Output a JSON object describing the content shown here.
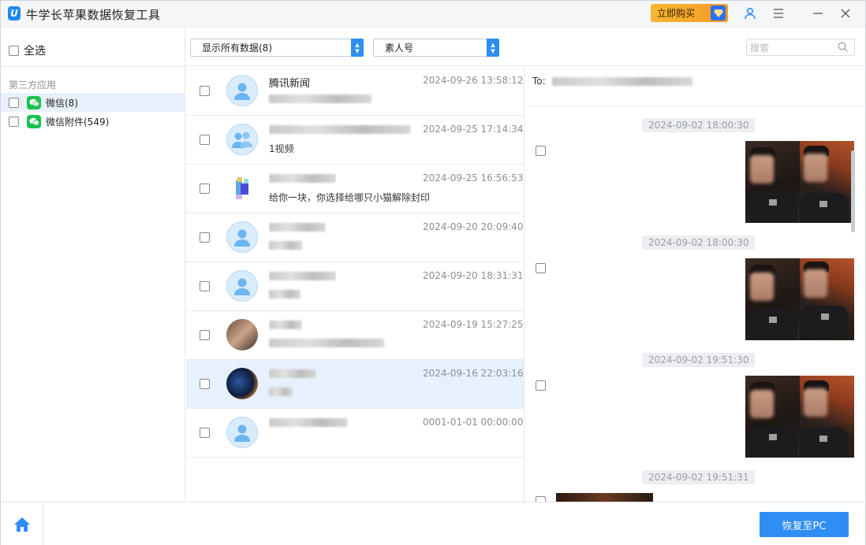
{
  "app": {
    "title": "牛学长苹果数据恢复工具",
    "logo_letter": "U",
    "buy_label": "立即购买",
    "accent": "#2f8ef4",
    "buy_color": "#f7b733",
    "icons": [
      "user-icon",
      "menu-icon",
      "minimize-icon",
      "close-icon"
    ]
  },
  "sidebar": {
    "select_all": "全选",
    "section": "第三方应用",
    "items": [
      {
        "label": "微信(8)",
        "active": true
      },
      {
        "label": "微信附件(549)",
        "active": false
      }
    ]
  },
  "toolbar": {
    "filter_value": "显示所有数据(8)",
    "type_value": "素人号",
    "search_placeholder": "搜索"
  },
  "list": {
    "rows": [
      {
        "name": "腾讯新闻",
        "preview": "",
        "time": "2024-09-26 13:58:12"
      },
      {
        "name": "",
        "preview": "1视频",
        "time": "2024-09-25 17:14:34"
      },
      {
        "name": "",
        "preview": "给你一块，你选择给哪只小猫解除封印",
        "time": "2024-09-25 16:56:53"
      },
      {
        "name": "",
        "preview": "",
        "time": "2024-09-20 20:09:40"
      },
      {
        "name": "",
        "preview": "",
        "time": "2024-09-20 18:31:31"
      },
      {
        "name": "",
        "preview": "",
        "time": "2024-09-19 15:27:25"
      },
      {
        "name": "",
        "preview": "",
        "time": "2024-09-16 22:03:16"
      },
      {
        "name": "",
        "preview": "",
        "time": "0001-01-01 00:00:00"
      }
    ]
  },
  "detail": {
    "to_label": "To:",
    "messages": [
      {
        "time": "2024-09-02 18:00:30"
      },
      {
        "time": "2024-09-02 18:00:30"
      },
      {
        "time": "2024-09-02 19:51:30"
      },
      {
        "time": "2024-09-02 19:51:31"
      }
    ]
  },
  "footer": {
    "restore_label": "恢复至PC"
  }
}
